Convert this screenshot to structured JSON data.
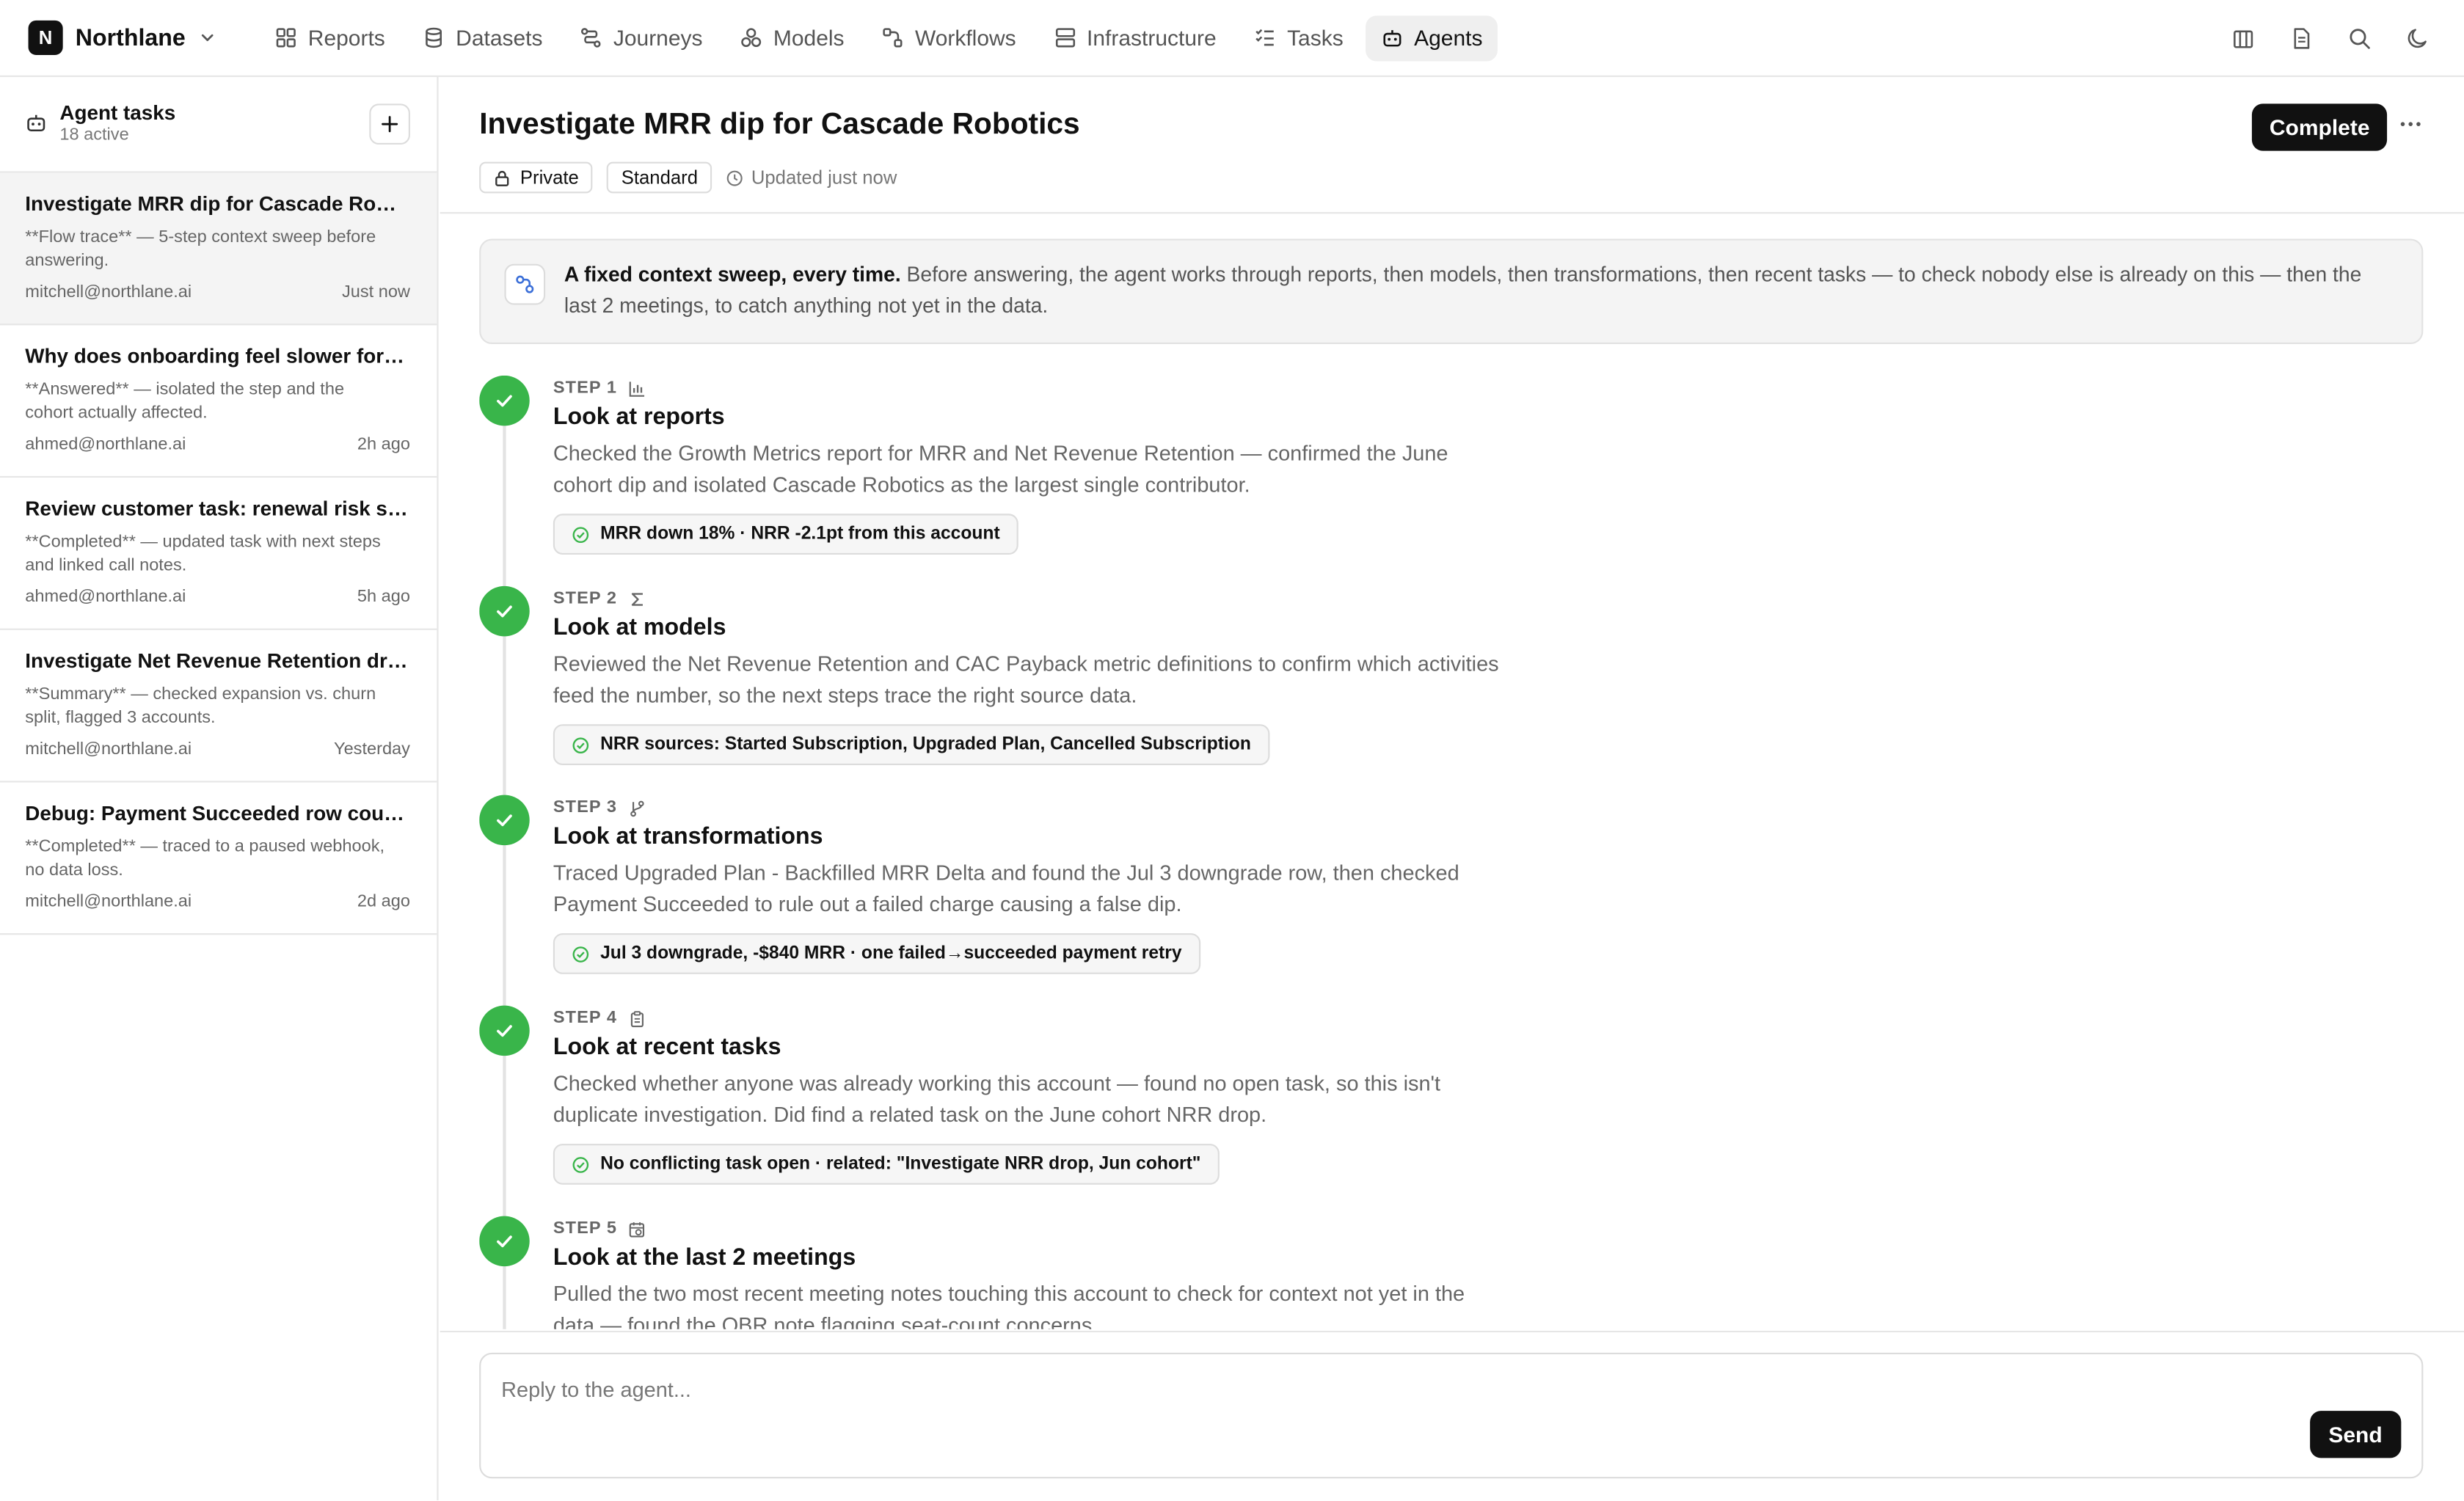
{
  "app": {
    "brand_initial": "N",
    "brand_name": "Northlane"
  },
  "nav": [
    {
      "label": "Reports",
      "icon": "grid-icon"
    },
    {
      "label": "Datasets",
      "icon": "database-icon"
    },
    {
      "label": "Journeys",
      "icon": "route-icon"
    },
    {
      "label": "Models",
      "icon": "cubes-icon"
    },
    {
      "label": "Workflows",
      "icon": "workflow-icon"
    },
    {
      "label": "Infrastructure",
      "icon": "server-icon"
    },
    {
      "label": "Tasks",
      "icon": "checklist-icon"
    },
    {
      "label": "Agents",
      "icon": "bot-icon",
      "active": true
    }
  ],
  "sidebar": {
    "title": "Agent tasks",
    "subtitle": "18 active",
    "tasks": [
      {
        "title": "Investigate MRR dip for Cascade Robotics",
        "snippet": "**Flow trace** — 5-step context sweep before answering.",
        "email": "mitchell@northlane.ai",
        "time": "Just now"
      },
      {
        "title": "Why does onboarding feel slower for new accounts",
        "snippet": "**Answered** — isolated the step and the cohort actually affected.",
        "email": "ahmed@northlane.ai",
        "time": "2h ago"
      },
      {
        "title": "Review customer task: renewal risk summary",
        "snippet": "**Completed** — updated task with next steps and linked call notes.",
        "email": "ahmed@northlane.ai",
        "time": "5h ago"
      },
      {
        "title": "Investigate Net Revenue Retention drop",
        "snippet": "**Summary** — checked expansion vs. churn split, flagged 3 accounts.",
        "email": "mitchell@northlane.ai",
        "time": "Yesterday"
      },
      {
        "title": "Debug: Payment Succeeded row count mismatch",
        "snippet": "**Completed** — traced to a paused webhook, no data loss.",
        "email": "mitchell@northlane.ai",
        "time": "2d ago"
      }
    ]
  },
  "main": {
    "title": "Investigate MRR dip for Cascade Robotics",
    "tag_private": "Private",
    "tag_standard": "Standard",
    "updated": "Updated just now",
    "complete_label": "Complete",
    "banner_bold": "A fixed context sweep, every time.",
    "banner_text": " Before answering, the agent works through reports, then models, then transformations, then recent tasks — to check nobody else is already on this — then the last 2 meetings, to catch anything not yet in the data.",
    "steps": [
      {
        "label": "STEP 1",
        "icon": "bar-chart-icon",
        "title": "Look at reports",
        "desc": "Checked the Growth Metrics report for MRR and Net Revenue Retention — confirmed the June cohort dip and isolated Cascade Robotics as the largest single contributor.",
        "result": "MRR down 18% · NRR -2.1pt from this account"
      },
      {
        "label": "STEP 2",
        "icon": "sigma-icon",
        "title": "Look at models",
        "desc": "Reviewed the Net Revenue Retention and CAC Payback metric definitions to confirm which activities feed the number, so the next steps trace the right source data.",
        "result": "NRR sources: Started Subscription, Upgraded Plan, Cancelled Subscription"
      },
      {
        "label": "STEP 3",
        "icon": "git-branch-icon",
        "title": "Look at transformations",
        "desc": "Traced Upgraded Plan - Backfilled MRR Delta and found the Jul 3 downgrade row, then checked Payment Succeeded to rule out a failed charge causing a false dip.",
        "result": "Jul 3 downgrade, -$840 MRR · one failed→succeeded payment retry"
      },
      {
        "label": "STEP 4",
        "icon": "clipboard-icon",
        "title": "Look at recent tasks",
        "desc": "Checked whether anyone was already working this account — found no open task, so this isn't duplicate investigation. Did find a related task on the June cohort NRR drop.",
        "result": "No conflicting task open · related: \"Investigate NRR drop, Jun cohort\""
      },
      {
        "label": "STEP 5",
        "icon": "calendar-clock-icon",
        "title": "Look at the last 2 meetings",
        "desc": "Pulled the two most recent meeting notes touching this account to check for context not yet in the data — found the QBR note flagging seat-count concerns.",
        "result": ""
      }
    ]
  },
  "composer": {
    "placeholder": "Reply to the agent...",
    "send_label": "Send"
  }
}
